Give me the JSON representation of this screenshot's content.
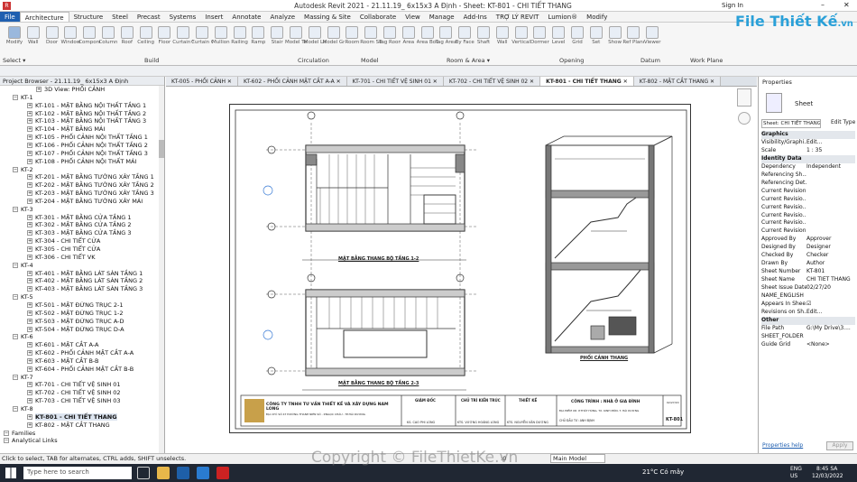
{
  "window": {
    "title": "Autodesk Revit 2021 - 21.11.19_ 6x15x3 A Định - Sheet: KT-801 - CHI TIẾT THANG",
    "sign_in": "Sign In"
  },
  "ribbon_tabs": [
    "File",
    "Architecture",
    "Structure",
    "Steel",
    "Precast",
    "Systems",
    "Insert",
    "Annotate",
    "Analyze",
    "Massing & Site",
    "Collaborate",
    "View",
    "Manage",
    "Add-Ins",
    "TRỢ LÝ REVIT",
    "Lumion®",
    "Modify"
  ],
  "ribbon_tools": [
    "Modify",
    "Wall",
    "Door",
    "Window",
    "Component",
    "Column",
    "Roof",
    "Ceiling",
    "Floor",
    "Curtain System",
    "Curtain Grid",
    "Mullion",
    "Railing",
    "Ramp",
    "Stair",
    "Model Text",
    "Model Line",
    "Model Group",
    "Room",
    "Room Separator",
    "Tag Room",
    "Area",
    "Area Boundary",
    "Tag Area",
    "By Face",
    "Shaft",
    "Wall",
    "Vertical",
    "Dormer",
    "Level",
    "Grid",
    "Set",
    "Show",
    "Ref Plane",
    "Viewer"
  ],
  "ribbon_panels": [
    "Select ▾",
    "Build",
    "Circulation",
    "Model",
    "Room & Area ▾",
    "Opening",
    "Datum",
    "Work Plane"
  ],
  "browser": {
    "title": "Project Browser - 21.11.19_ 6x15x3 A Định",
    "items": [
      "3D View: PHỐI CẢNH",
      "KT-1",
      "KT-101 - MẶT BẰNG NỘI THẤT TẦNG 1",
      "KT-102 - MẶT BẰNG NỘI THẤT TẦNG 2",
      "KT-103 - MẶT BẰNG NỘI THẤT TẦNG 3",
      "KT-104 - MẶT BẰNG MÁI",
      "KT-105 - PHỐI CẢNH NỘI THẤT TẦNG 1",
      "KT-106 - PHỐI CẢNH NỘI THẤT TẦNG 2",
      "KT-107 - PHỐI CẢNH NỘI THẤT TẦNG 3",
      "KT-108 - PHỐI CẢNH NỘI THẤT MÁI",
      "KT-2",
      "KT-201 - MẶT BẰNG TƯỜNG XÂY TẦNG 1",
      "KT-202 - MẶT BẰNG TƯỜNG XÂY TẦNG 2",
      "KT-203 - MẶT BẰNG TƯỜNG XÂY TẦNG 3",
      "KT-204 - MẶT BẰNG TƯỜNG XÂY MÁI",
      "KT-3",
      "KT-301 - MẶT BẰNG CỬA TẦNG 1",
      "KT-302 - MẶT BẰNG CỬA TẦNG 2",
      "KT-303 - MẶT BẰNG CỬA TẦNG 3",
      "KT-304 - CHI TIẾT CỬA",
      "KT-305 - CHI TIẾT CỬA",
      "KT-306 - CHI TIẾT VK",
      "KT-4",
      "KT-401 - MẶT BẰNG LÁT SÀN TẦNG 1",
      "KT-402 - MẶT BẰNG LÁT SÀN TẦNG 2",
      "KT-403 - MẶT BẰNG LÁT SÀN TẦNG 3",
      "KT-5",
      "KT-501 - MẶT ĐỨNG TRỤC 2-1",
      "KT-502 - MẶT ĐỨNG TRỤC 1-2",
      "KT-503 - MẶT ĐỨNG TRỤC A-D",
      "KT-504 - MẶT ĐỨNG TRỤC D-A",
      "KT-6",
      "KT-601 - MẶT CẮT A-A",
      "KT-602 - PHỐI CẢNH MẶT CẮT A-A",
      "KT-603 - MẶT CẮT B-B",
      "KT-604 - PHỐI CẢNH MẶT CẮT B-B",
      "KT-7",
      "KT-701 - CHI TIẾT VỆ SINH 01",
      "KT-702 - CHI TIẾT VỆ SINH 02",
      "KT-703 - CHI TIẾT VỆ SINH 03",
      "KT-8",
      "KT-801 - CHI TIẾT THANG",
      "KT-802 - MẶT CẮT THANG",
      "Families",
      "Analytical Links"
    ]
  },
  "doc_tabs": [
    "KT-005 - PHỐI CẢNH",
    "KT-602 - PHỐI CẢNH MẶT CẮT A-A",
    "KT-701 - CHI TIẾT VỆ SINH 01",
    "KT-702 - CHI TIẾT VỆ SINH 02",
    "KT-801 - CHI TIẾT THANG",
    "KT-802 - MẶT CẮT THANG"
  ],
  "sheet": {
    "plan1_title": "MẶT BẰNG THANG BỘ TẦNG 1-2",
    "plan2_title": "MẶT BẰNG THANG BỘ TẦNG 2-3",
    "persp_title": "PHỐI CẢNH THANG",
    "company": "CÔNG TY TNHH TƯ VẤN THIẾT KẾ VÀ XÂY DỰNG NAM LONG",
    "company_addr": "ĐỊA CHỈ: SỐ 47 ĐƯỜNG THANH NIÊN SỐ - P.NGỌC CHÂU - TP.HẢI DƯƠNG",
    "giam_doc": "GIÁM ĐỐC",
    "chu_tri": "CHỦ TRÌ KIẾN TRÚC",
    "thiet_ke": "THIẾT KẾ",
    "gd_name": "KS. CAO PHI LONG",
    "ct_name": "KTS. VƯƠNG HOÀNG LONG",
    "tk_name": "KTS. NGUYỄN VĂN DƯƠNG",
    "project": "CÔNG TRÌNH : NHÀ Ở GIA ĐÌNH",
    "location": "ĐỊA ĐIỂM XD: P.THẤT HÙNG, TX. KINH MÔN, T. HẢI DƯƠNG",
    "owner": "CHỦ ĐẦU TƯ: ANH ĐỊNH",
    "sheet_no": "KT-801",
    "date": "02/27/20"
  },
  "properties": {
    "title": "Properties",
    "type": "Sheet",
    "selector": "Sheet: CHI TIẾT THANG",
    "edit_type": "Edit Type",
    "rows": [
      {
        "k": "Graphics",
        "v": "",
        "g": true
      },
      {
        "k": "Visibility/Graphi...",
        "v": "Edit..."
      },
      {
        "k": "Scale",
        "v": "1 : 35"
      },
      {
        "k": "Identity Data",
        "v": "",
        "g": true
      },
      {
        "k": "Dependency",
        "v": "Independent"
      },
      {
        "k": "Referencing Sh...",
        "v": ""
      },
      {
        "k": "Referencing Det...",
        "v": ""
      },
      {
        "k": "Current Revision...",
        "v": ""
      },
      {
        "k": "Current Revisio...",
        "v": ""
      },
      {
        "k": "Current Revisio...",
        "v": ""
      },
      {
        "k": "Current Revisio...",
        "v": ""
      },
      {
        "k": "Current Revisio...",
        "v": ""
      },
      {
        "k": "Current Revision",
        "v": ""
      },
      {
        "k": "Approved By",
        "v": "Approver"
      },
      {
        "k": "Designed By",
        "v": "Designer"
      },
      {
        "k": "Checked By",
        "v": "Checker"
      },
      {
        "k": "Drawn By",
        "v": "Author"
      },
      {
        "k": "Sheet Number",
        "v": "KT-801"
      },
      {
        "k": "Sheet Name",
        "v": "CHI TIẾT THANG"
      },
      {
        "k": "Sheet Issue Date",
        "v": "02/27/20"
      },
      {
        "k": "NAME_ENGLISH",
        "v": ""
      },
      {
        "k": "Appears In Shee...",
        "v": "☑"
      },
      {
        "k": "Revisions on Sh...",
        "v": "Edit..."
      },
      {
        "k": "Other",
        "v": "",
        "g": true
      },
      {
        "k": "File Path",
        "v": "G:\\My Drive\\3...."
      },
      {
        "k": "SHEET_FOLDER",
        "v": ""
      },
      {
        "k": "Guide Grid",
        "v": "<None>"
      }
    ],
    "help": "Properties help",
    "apply": "Apply"
  },
  "status": {
    "text": "Click to select, TAB for alternates, CTRL adds, SHIFT unselects.",
    "scale": ":0",
    "model": "Main Model"
  },
  "taskbar": {
    "search": "Type here to search",
    "weather": "21°C Có mây",
    "lang": "ENG",
    "lang2": "US",
    "time": "8:45 SA",
    "date": "12/03/2022"
  },
  "watermark": {
    "brand": "File Thiết Kế",
    "brand_suffix": ".vn",
    "copyright": "Copyright © FileThietKe.vn"
  },
  "colors": {
    "accent": "#1f5fb0",
    "taskbar": "#202733",
    "watermark": "#2aa0d8"
  }
}
